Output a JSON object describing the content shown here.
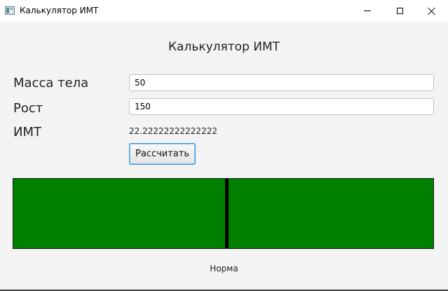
{
  "window": {
    "title": "Калькулятор ИМТ",
    "icon": "app-window-icon",
    "controls": [
      "minimize-icon",
      "maximize-icon",
      "close-icon"
    ]
  },
  "main": {
    "heading": "Калькулятор ИМТ",
    "mass": {
      "label": "Масса тела",
      "value": "50"
    },
    "height": {
      "label": "Рост",
      "value": "150"
    },
    "bmi": {
      "label": "ИМТ",
      "value": "22.22222222222222"
    },
    "calculate_button": "Рассчитать"
  },
  "gauge": {
    "fill_color": "#008000",
    "marker_color": "#000000",
    "marker_position_fraction": 0.507
  },
  "status": "Норма"
}
